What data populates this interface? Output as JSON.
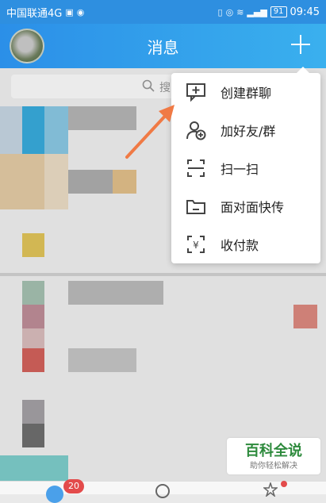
{
  "statusbar": {
    "carrier": "中国联通4G",
    "network": "4G",
    "battery": "91",
    "time": "09:45"
  },
  "header": {
    "title": "消息"
  },
  "search": {
    "label": "搜"
  },
  "menu": {
    "items": [
      {
        "label": "创建群聊",
        "icon": "chat-add-icon"
      },
      {
        "label": "加好友/群",
        "icon": "add-friend-icon"
      },
      {
        "label": "扫一扫",
        "icon": "scan-icon"
      },
      {
        "label": "面对面快传",
        "icon": "folder-icon"
      },
      {
        "label": "收付款",
        "icon": "payment-icon"
      }
    ]
  },
  "tabbar": {
    "badge": "20"
  },
  "watermark": {
    "title": "百科全说",
    "subtitle": "助你轻松解决"
  },
  "colors": {
    "accent": "#2e8fe0",
    "arrow": "#f07a45",
    "badge": "#e34b4b",
    "watermark_green": "#2d8a3c"
  }
}
